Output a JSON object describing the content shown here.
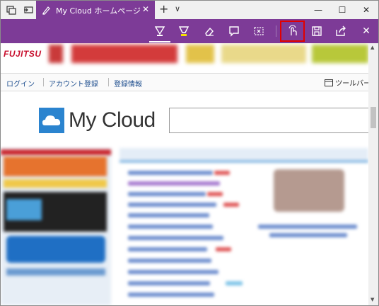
{
  "tab": {
    "title": "My Cloud ホームページ"
  },
  "page": {
    "brand": "FUJITSU",
    "nav": {
      "login": "ログイン",
      "register": "アカウント登録",
      "info": "登録情報",
      "tools": "ツールバー"
    },
    "logo_text": "My Cloud"
  },
  "colors": {
    "accent": "#7d3b97",
    "highlight": "#e00000"
  }
}
